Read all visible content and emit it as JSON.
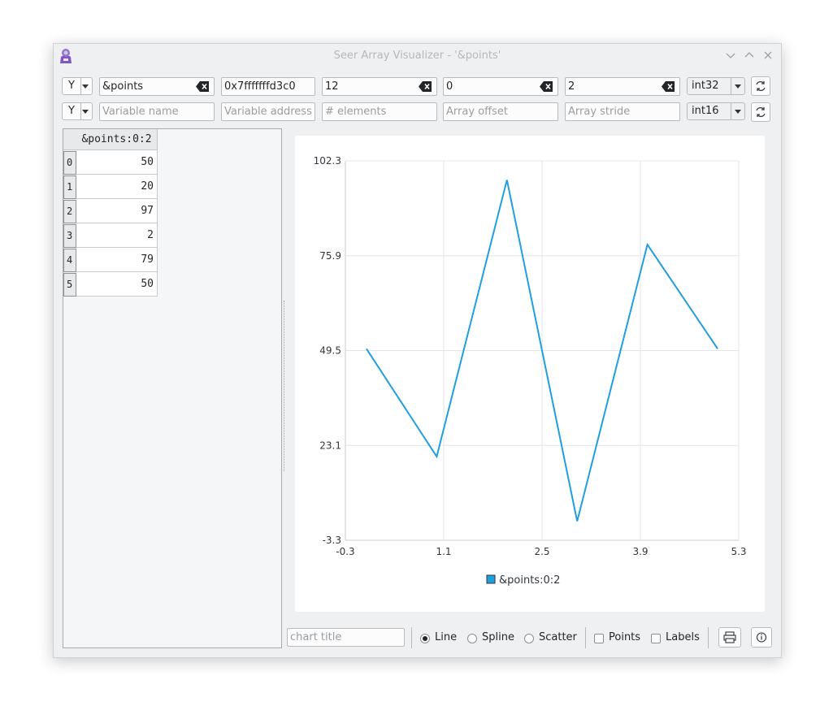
{
  "window": {
    "title": "Seer Array Visualizer - '&points'"
  },
  "rows": [
    {
      "axis": "Y",
      "name": "&points",
      "name_placeholder": "Variable name",
      "address": "0x7fffffffd3c0",
      "address_placeholder": "Variable address",
      "elements": "12",
      "elements_placeholder": "# elements",
      "offset": "0",
      "offset_placeholder": "Array offset",
      "stride": "2",
      "stride_placeholder": "Array stride",
      "type": "int32"
    },
    {
      "axis": "Y",
      "name": "",
      "name_placeholder": "Variable name",
      "address": "",
      "address_placeholder": "Variable address",
      "elements": "",
      "elements_placeholder": "# elements",
      "offset": "",
      "offset_placeholder": "Array offset",
      "stride": "",
      "stride_placeholder": "Array stride",
      "type": "int16"
    }
  ],
  "table": {
    "column_header": "&points:0:2",
    "rows": [
      {
        "index": "0",
        "value": "50"
      },
      {
        "index": "1",
        "value": "20"
      },
      {
        "index": "2",
        "value": "97"
      },
      {
        "index": "3",
        "value": "2"
      },
      {
        "index": "4",
        "value": "79"
      },
      {
        "index": "5",
        "value": "50"
      }
    ]
  },
  "chart_data": {
    "type": "line",
    "x": [
      0,
      1,
      2,
      3,
      4,
      5
    ],
    "series": [
      {
        "name": "&points:0:2",
        "values": [
          50,
          20,
          97,
          2,
          79,
          50
        ],
        "color": "#209fdf"
      }
    ],
    "xlim": [
      -0.3,
      5.3
    ],
    "ylim": [
      -3.3,
      102.3
    ],
    "x_ticks": [
      "-0.3",
      "1.1",
      "2.5",
      "3.9",
      "5.3"
    ],
    "y_ticks": [
      "102.3",
      "75.9",
      "49.5",
      "23.1",
      "-3.3"
    ],
    "grid": true,
    "legend": "bottom"
  },
  "controls": {
    "chart_title_placeholder": "chart title",
    "line_label": "Line",
    "spline_label": "Spline",
    "scatter_label": "Scatter",
    "points_label": "Points",
    "labels_label": "Labels",
    "selected_style": "Line"
  },
  "icons": {
    "app": "seer-app-icon",
    "clear": "clear-text-icon",
    "refresh": "refresh-icon",
    "print": "print-icon",
    "info": "info-icon"
  },
  "colors": {
    "accent": "#209fdf",
    "window_bg": "#eff0f1"
  }
}
